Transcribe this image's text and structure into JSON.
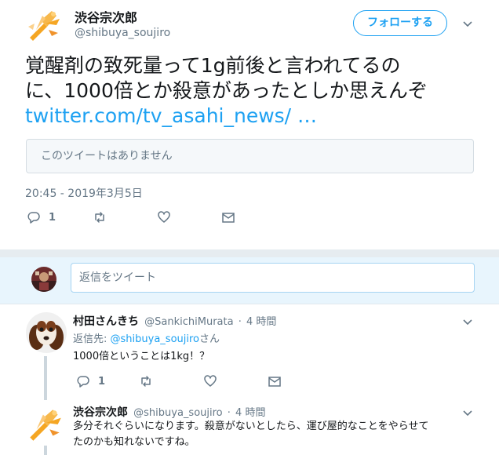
{
  "tweet": {
    "display_name": "渋谷宗次郎",
    "handle": "@shibuya_soujiro",
    "follow_label": "フォローする",
    "text_line1": "覚醒剤の致死量って1g前後と言われてるの",
    "text_line2": "に、1000倍とか殺意があったとしか思えんぞ",
    "link_text": "twitter.com/tv_asahi_news/ …",
    "quote_unavailable": "このツイートはありません",
    "timestamp": "20:45 - 2019年3月5日",
    "reply_count": "1"
  },
  "reply_box": {
    "placeholder": "返信をツイート"
  },
  "replies": [
    {
      "display_name": "村田さんきち",
      "handle": "@SankichiMurata",
      "dot": "·",
      "time": "4 時間",
      "replying_prefix": "返信先: ",
      "replying_mention": "@shibuya_soujiro",
      "replying_suffix": "さん",
      "text": "1000倍ということは1kg！？",
      "reply_count": "1"
    },
    {
      "display_name": "渋谷宗次郎",
      "handle": "@shibuya_soujiro",
      "dot": "·",
      "time": "4 時間",
      "text_line1": "多分それぐらいになります。殺意がないとしたら、運び屋的なことをやらせて",
      "text_line2": "たのかも知れないですね。"
    }
  ],
  "colors": {
    "accent": "#1da1f2",
    "secondary_text": "#657786",
    "separator": "#e6ecf0",
    "reply_bar_bg": "#e8f5fd"
  },
  "icons": [
    "reply-icon",
    "retweet-icon",
    "like-icon",
    "message-icon",
    "chevron-down-icon"
  ]
}
